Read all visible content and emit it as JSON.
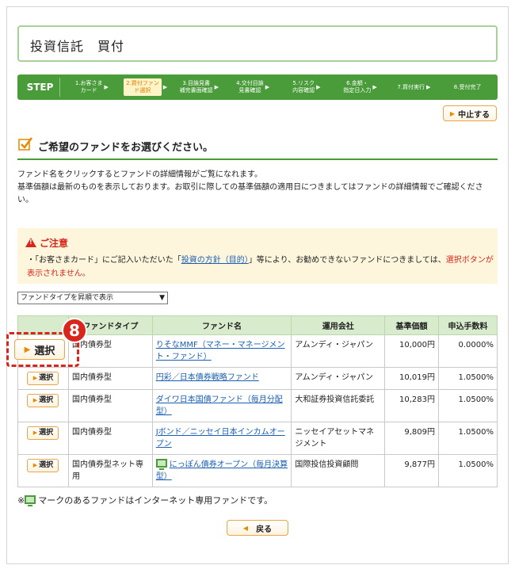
{
  "page": {
    "title": "投資信託　買付"
  },
  "steps": {
    "label": "STEP",
    "items": [
      {
        "label": "1.お客さま\nカード",
        "active": false
      },
      {
        "label": "2.買付ファン\nド選択",
        "active": true
      },
      {
        "label": "3.目論見書\n補完書面確認",
        "active": false
      },
      {
        "label": "4.交付目論\n見書確認",
        "active": false
      },
      {
        "label": "5.リスク\n内容確認",
        "active": false
      },
      {
        "label": "6.金額・\n指定日入力",
        "active": false
      },
      {
        "label": "7.買付実行",
        "active": false
      },
      {
        "label": "8.受付完了",
        "active": false
      }
    ]
  },
  "actions": {
    "stop_label": "中止する",
    "back_label": "戻る"
  },
  "section": {
    "heading": "ご希望のファンドをお選びください。"
  },
  "intro": {
    "line1": "ファンド名をクリックするとファンドの詳細情報がご覧になれます。",
    "line2": "基準価額は最新のものを表示しております。お取引に際しての基準価額の適用日につきましてはファンドの詳細情報でご確認ください。"
  },
  "notice": {
    "title": "ご注意",
    "text_before": "・「お客さまカード」にご記入いただいた「",
    "link": "投資の方針（目的）",
    "text_middle": "」等により、お勧めできないファンドにつきましては、",
    "text_red": "選択ボタンが表示されません。"
  },
  "sort": {
    "selected": "ファンドタイプを昇順で表示"
  },
  "table": {
    "headers": [
      "",
      "ファンドタイプ",
      "ファンド名",
      "運用会社",
      "基準価額",
      "申込手数料"
    ],
    "select_label": "選択",
    "rows": [
      {
        "type": "国内債券型",
        "name": "りそなMMF（マネー・マネージメント・ファンド）",
        "company": "アムンディ・ジャパン",
        "price": "10,000円",
        "fee": "0.0000%",
        "net_only": false
      },
      {
        "type": "国内債券型",
        "name": "円彩／日本債券戦略ファンド",
        "company": "アムンディ・ジャパン",
        "price": "10,019円",
        "fee": "1.0500%",
        "net_only": false
      },
      {
        "type": "国内債券型",
        "name": "ダイワ日本国債ファンド（毎月分配型）",
        "company": "大和証券投資信託委託",
        "price": "10,283円",
        "fee": "1.0500%",
        "net_only": false
      },
      {
        "type": "国内債券型",
        "name": "Jボンド／ニッセイ日本インカムオープン",
        "company": "ニッセイアセットマネジメント",
        "price": "9,809円",
        "fee": "1.0500%",
        "net_only": false
      },
      {
        "type": "国内債券型ネット専用",
        "name": "にっぽん債券オープン（毎月決算型）",
        "company": "国際投信投資顧問",
        "price": "9,877円",
        "fee": "1.0500%",
        "net_only": true
      }
    ]
  },
  "callout": {
    "number": "8",
    "button_label": "選択"
  },
  "footnote": {
    "prefix": "※",
    "text": "マークのあるファンドはインターネット専用ファンドです。"
  },
  "colors": {
    "brand_green": "#4a9b3a",
    "accent_orange": "#e68a00",
    "alert_red": "#d9261c"
  }
}
